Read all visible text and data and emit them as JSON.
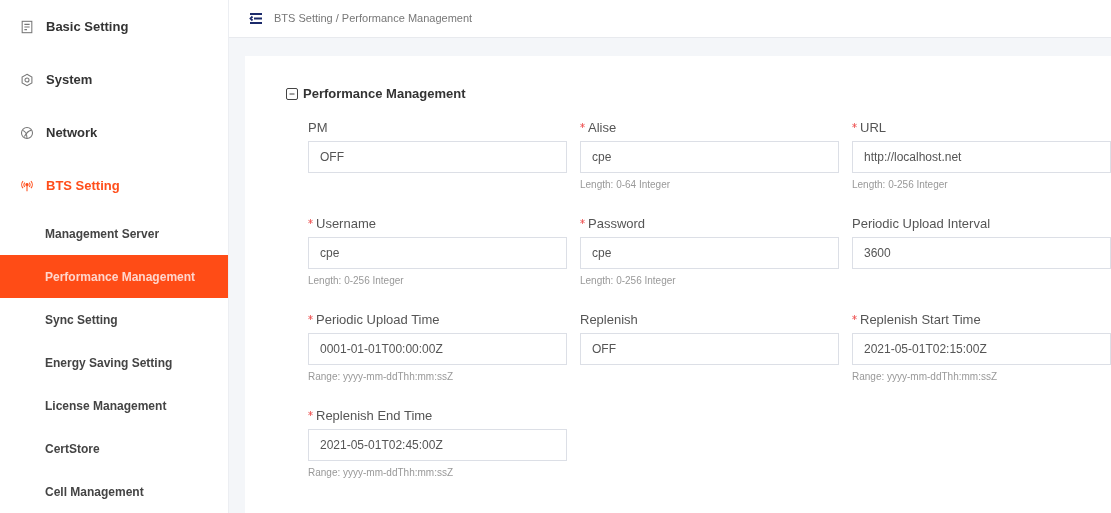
{
  "sidebar": {
    "items": [
      {
        "kind": "top",
        "label": "Basic Setting",
        "active": false
      },
      {
        "kind": "top",
        "label": "System",
        "active": false
      },
      {
        "kind": "top",
        "label": "Network",
        "active": false
      },
      {
        "kind": "top",
        "label": "BTS Setting",
        "active": true
      },
      {
        "kind": "sub",
        "label": "Management Server",
        "selected": false
      },
      {
        "kind": "sub",
        "label": "Performance Management",
        "selected": true
      },
      {
        "kind": "sub",
        "label": "Sync Setting",
        "selected": false
      },
      {
        "kind": "sub",
        "label": "Energy Saving Setting",
        "selected": false
      },
      {
        "kind": "sub",
        "label": "License Management",
        "selected": false
      },
      {
        "kind": "sub",
        "label": "CertStore",
        "selected": false
      },
      {
        "kind": "sub",
        "label": "Cell Management",
        "selected": false
      }
    ]
  },
  "breadcrumb": "BTS Setting / Performance Management",
  "section": {
    "title": "Performance Management",
    "expanded": true
  },
  "fields": [
    {
      "label": "PM",
      "required": false,
      "value": "OFF"
    },
    {
      "label": "Alise",
      "required": true,
      "value": "cpe",
      "hint": "Length: 0-64 Integer"
    },
    {
      "label": "URL",
      "required": true,
      "value": "http://localhost.net",
      "hint": "Length: 0-256 Integer"
    },
    {
      "label": "Username",
      "required": true,
      "value": "cpe",
      "hint": "Length: 0-256 Integer"
    },
    {
      "label": "Password",
      "required": true,
      "value": "cpe",
      "hint": "Length: 0-256 Integer"
    },
    {
      "label": "Periodic Upload Interval",
      "required": false,
      "value": "3600"
    },
    {
      "label": "Periodic Upload Time",
      "required": true,
      "value": "0001-01-01T00:00:00Z",
      "hint": "Range: yyyy-mm-ddThh:mm:ssZ"
    },
    {
      "label": "Replenish",
      "required": false,
      "value": "OFF"
    },
    {
      "label": "Replenish Start Time",
      "required": true,
      "value": "2021-05-01T02:15:00Z",
      "hint": "Range: yyyy-mm-ddThh:mm:ssZ"
    },
    {
      "label": "Replenish End Time",
      "required": true,
      "value": "2021-05-01T02:45:00Z",
      "hint": "Range: yyyy-mm-ddThh:mm:ssZ"
    }
  ]
}
